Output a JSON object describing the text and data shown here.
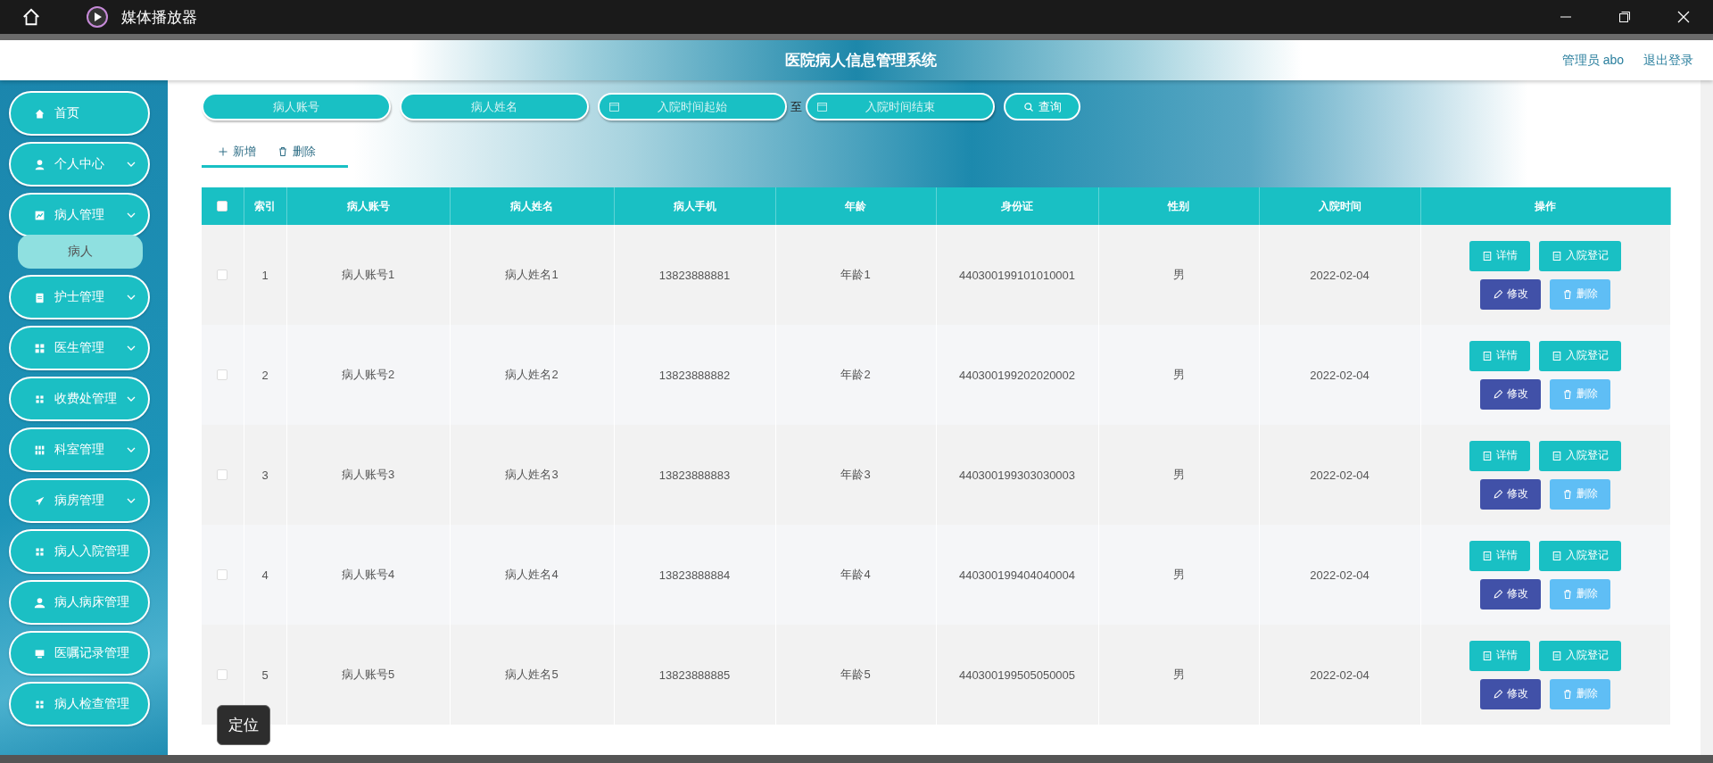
{
  "app_bar": {
    "title": "媒体播放器"
  },
  "header": {
    "title": "医院病人信息管理系统",
    "user": "管理员 abo",
    "logout": "退出登录"
  },
  "sidebar": {
    "items": [
      {
        "label": "首页",
        "kind": "link"
      },
      {
        "label": "个人中心",
        "kind": "menu"
      },
      {
        "label": "病人管理",
        "kind": "menu",
        "children": [
          {
            "label": "病人",
            "selected": true
          }
        ]
      },
      {
        "label": "护士管理",
        "kind": "menu"
      },
      {
        "label": "医生管理",
        "kind": "menu"
      },
      {
        "label": "收费处管理",
        "kind": "menu"
      },
      {
        "label": "科室管理",
        "kind": "menu"
      },
      {
        "label": "病房管理",
        "kind": "menu"
      },
      {
        "label": "病人入院管理",
        "kind": "menu"
      },
      {
        "label": "病人病床管理",
        "kind": "menu"
      },
      {
        "label": "医嘱记录管理",
        "kind": "menu"
      },
      {
        "label": "病人检查管理",
        "kind": "menu"
      }
    ]
  },
  "search": [
    {
      "kind": "text",
      "placeholder": "病人账号"
    },
    {
      "kind": "text",
      "placeholder": "病人姓名"
    },
    {
      "kind": "date",
      "placeholder": "入院时间起始"
    },
    {
      "kind": "separator",
      "text": "至"
    },
    {
      "kind": "date",
      "placeholder": "入院时间结束"
    },
    {
      "kind": "button",
      "label": "查询"
    }
  ],
  "actions": [
    {
      "kind": "add",
      "label": "新增"
    },
    {
      "kind": "delete",
      "label": "删除"
    }
  ],
  "table": {
    "select_all": {
      "checked": false
    },
    "columns": [
      "索引",
      "病人账号",
      "病人姓名",
      "病人手机",
      "年龄",
      "身份证",
      "性别",
      "入院时间",
      "操作"
    ],
    "rows": [
      {
        "checked": false,
        "cells": [
          "1",
          "病人账号1",
          "病人姓名1",
          "13823888881",
          "年龄1",
          "440300199101010001",
          "男",
          "2022-02-04"
        ],
        "actions": [
          {
            "kind": "detail",
            "label": "详情"
          },
          {
            "kind": "register",
            "label": "入院登记"
          },
          {
            "kind": "edit",
            "label": "修改"
          },
          {
            "kind": "delete",
            "label": "删除"
          }
        ]
      },
      {
        "checked": false,
        "cells": [
          "2",
          "病人账号2",
          "病人姓名2",
          "13823888882",
          "年龄2",
          "440300199202020002",
          "男",
          "2022-02-04"
        ],
        "actions": [
          {
            "kind": "detail",
            "label": "详情"
          },
          {
            "kind": "register",
            "label": "入院登记"
          },
          {
            "kind": "edit",
            "label": "修改"
          },
          {
            "kind": "delete",
            "label": "删除"
          }
        ]
      },
      {
        "checked": false,
        "cells": [
          "3",
          "病人账号3",
          "病人姓名3",
          "13823888883",
          "年龄3",
          "440300199303030003",
          "男",
          "2022-02-04"
        ],
        "actions": [
          {
            "kind": "detail",
            "label": "详情"
          },
          {
            "kind": "register",
            "label": "入院登记"
          },
          {
            "kind": "edit",
            "label": "修改"
          },
          {
            "kind": "delete",
            "label": "删除"
          }
        ]
      },
      {
        "checked": false,
        "cells": [
          "4",
          "病人账号4",
          "病人姓名4",
          "13823888884",
          "年龄4",
          "440300199404040004",
          "男",
          "2022-02-04"
        ],
        "actions": [
          {
            "kind": "detail",
            "label": "详情"
          },
          {
            "kind": "register",
            "label": "入院登记"
          },
          {
            "kind": "edit",
            "label": "修改"
          },
          {
            "kind": "delete",
            "label": "删除"
          }
        ]
      },
      {
        "checked": false,
        "cells": [
          "5",
          "病人账号5",
          "病人姓名5",
          "13823888885",
          "年龄5",
          "440300199505050005",
          "男",
          "2022-02-04"
        ],
        "actions": [
          {
            "kind": "detail",
            "label": "详情"
          },
          {
            "kind": "register",
            "label": "入院登记"
          },
          {
            "kind": "edit",
            "label": "修改"
          },
          {
            "kind": "delete",
            "label": "删除"
          }
        ]
      }
    ]
  },
  "tooltip": {
    "text": "定位"
  }
}
